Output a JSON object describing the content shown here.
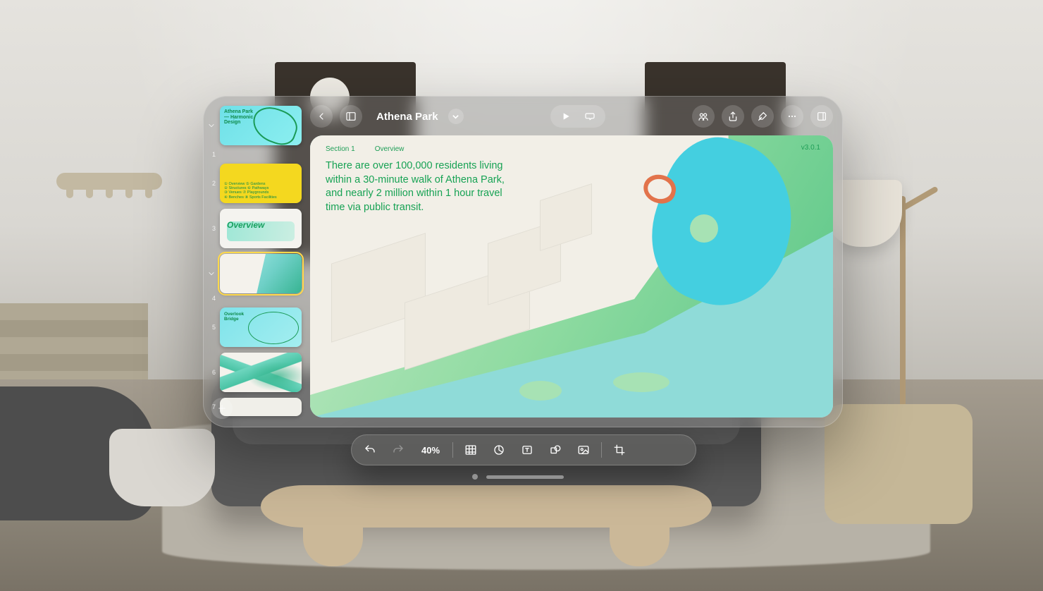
{
  "document": {
    "title": "Athena Park",
    "version": "v3.0.1"
  },
  "slide": {
    "section_label": "Section 1",
    "section_name": "Overview",
    "body": "There are over 100,000 residents living within a 30-minute walk of Athena Park, and nearly 2 million within 1 hour travel time via public transit."
  },
  "thumbnails": [
    {
      "n": "1",
      "title": "Athena Park\n— Harmonic\nDesign"
    },
    {
      "n": "2",
      "lists": "① Overview   ⑤ Gardens\n② Structures  ⑥ Pathways\n③ Venues     ⑦ Playgrounds\n④ Benches   ⑧ Sports Facilities"
    },
    {
      "n": "3",
      "title": "Overview"
    },
    {
      "n": "4"
    },
    {
      "n": "5",
      "title": "Overlook\nBridge"
    },
    {
      "n": "6"
    },
    {
      "n": "7"
    }
  ],
  "toolbar": {
    "zoom": "40%"
  }
}
